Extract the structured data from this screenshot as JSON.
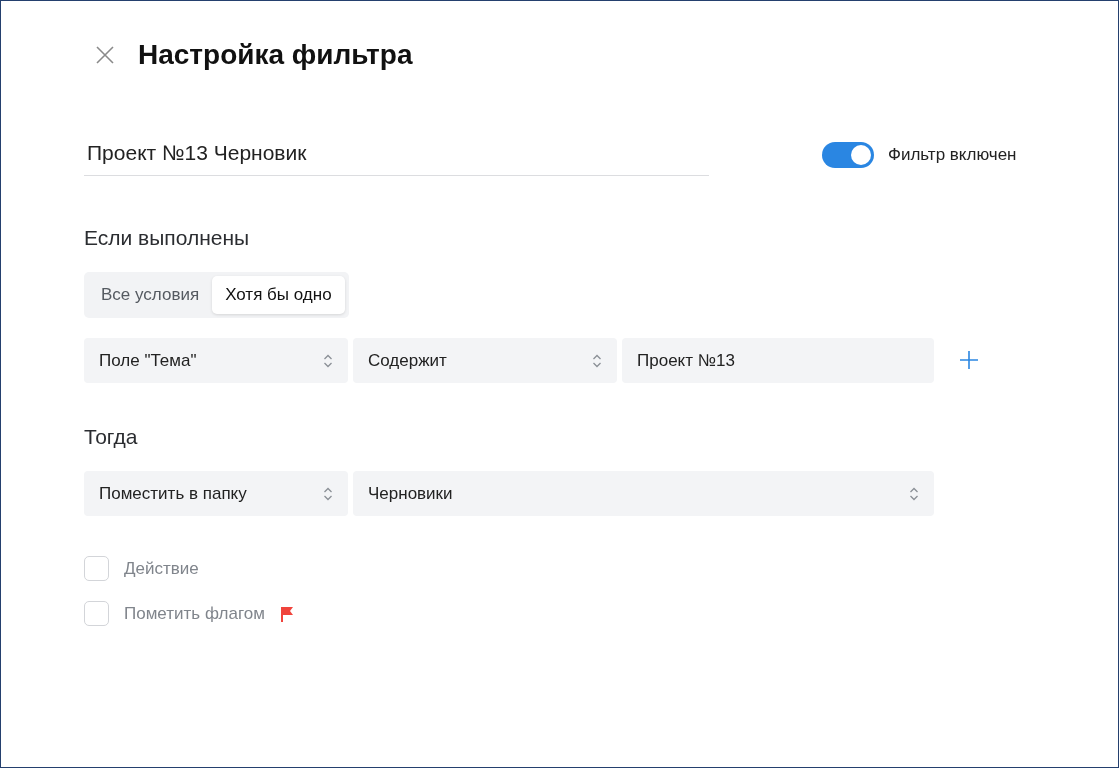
{
  "dialog": {
    "title": "Настройка фильтра"
  },
  "filter_name": {
    "value": "Проект №13 Черновик"
  },
  "enabled_toggle": {
    "on": true,
    "label": "Фильтр включен"
  },
  "conditions": {
    "heading": "Если выполнены",
    "match_tabs": [
      {
        "label": "Все условия",
        "selected": false
      },
      {
        "label": "Хотя бы одно",
        "selected": true
      }
    ],
    "rule": {
      "field": "Поле \"Тема\"",
      "operator": "Содержит",
      "value": "Проект №13"
    }
  },
  "actions": {
    "heading": "Тогда",
    "action": "Поместить в папку",
    "folder": "Черновики",
    "options": [
      {
        "label": "Действие",
        "checked": false,
        "kind": "plain"
      },
      {
        "label": "Пометить флагом",
        "checked": false,
        "kind": "flag"
      }
    ]
  }
}
